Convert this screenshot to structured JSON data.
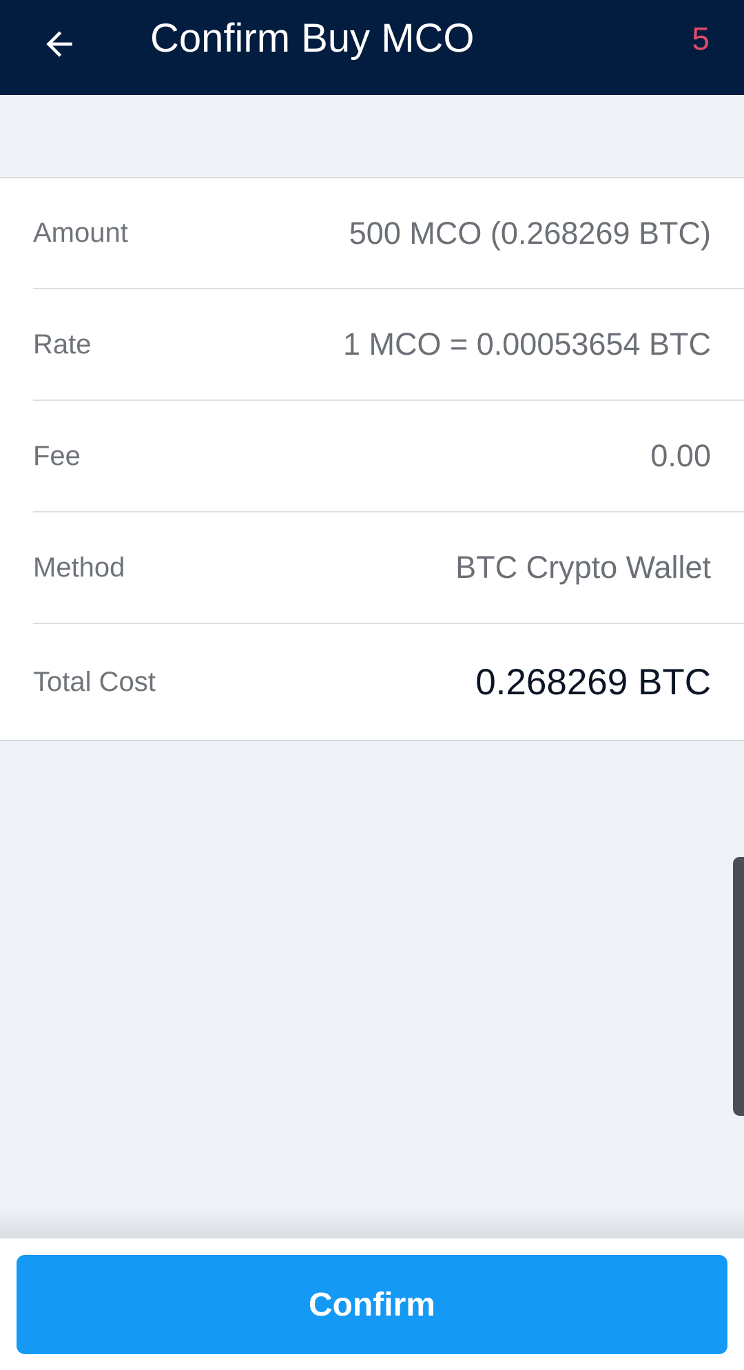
{
  "header": {
    "title": "Confirm Buy MCO",
    "counter": "5"
  },
  "details": {
    "rows": [
      {
        "label": "Amount",
        "value": "500 MCO (0.268269 BTC)"
      },
      {
        "label": "Rate",
        "value": "1 MCO = 0.00053654 BTC"
      },
      {
        "label": "Fee",
        "value": "0.00"
      },
      {
        "label": "Method",
        "value": "BTC Crypto Wallet"
      },
      {
        "label": "Total Cost",
        "value": "0.268269 BTC"
      }
    ]
  },
  "footer": {
    "confirm_label": "Confirm"
  },
  "colors": {
    "header_bg": "#021d3f",
    "accent": "#1499f4",
    "counter": "#e34b6a"
  }
}
